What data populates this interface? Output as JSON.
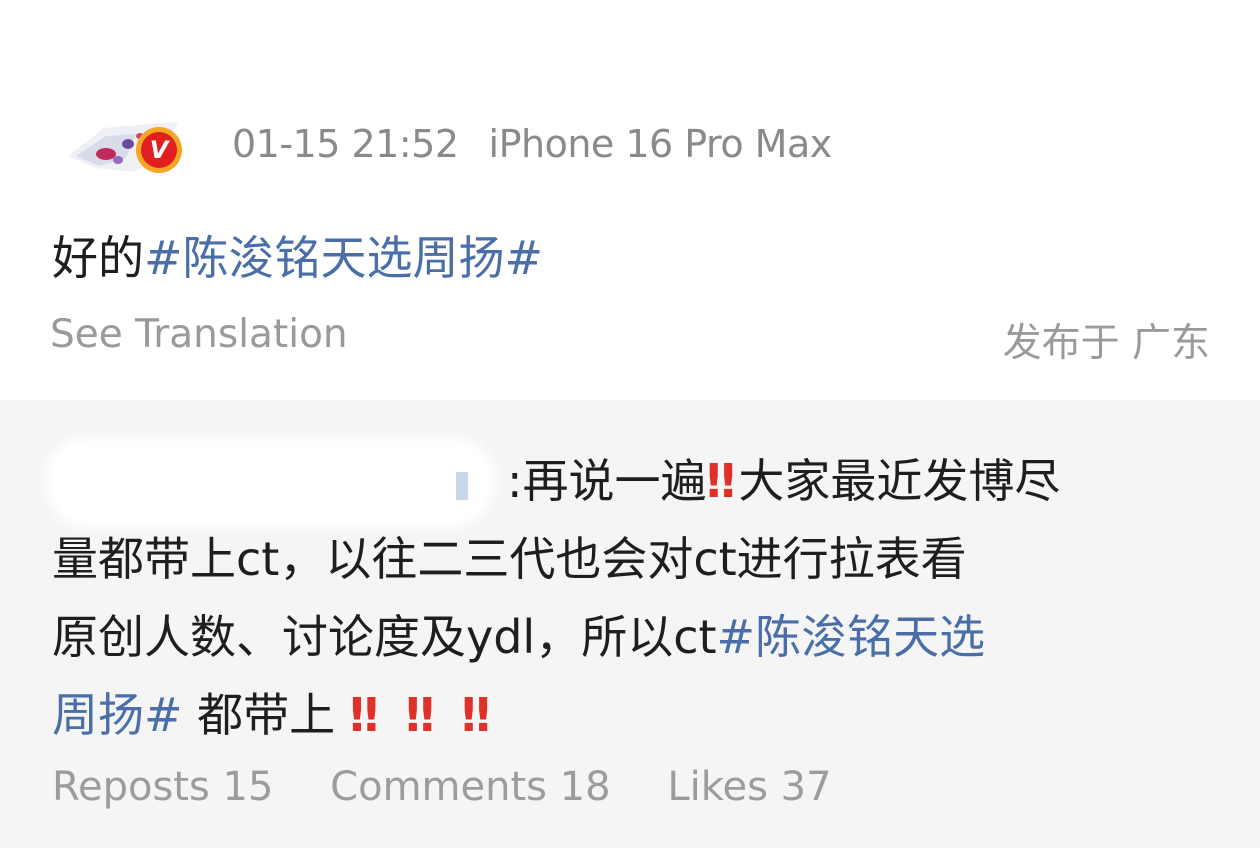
{
  "post": {
    "time": "01-15 21:52",
    "device": "iPhone 16 Pro Max",
    "text_plain": "好的",
    "text_hashtag": "#陈浚铭天选周扬#",
    "see_translation": "See Translation",
    "location": "发布于 广东"
  },
  "avatar": {
    "badge_letter": "V"
  },
  "repost": {
    "line1_text": ":再说一遍",
    "line1_text_b": "大家最近发博尽",
    "line2_text": "量都带上ct，以往二三代也会对ct进行拉表看",
    "line3_text": "原创人数、讨论度及ydl，所以ct",
    "line3_hashtag": "#陈浚铭天选",
    "line4_hashtag": "周扬#",
    "line4_text": " 都带上",
    "emphasis_mark": "‼"
  },
  "stats": {
    "reposts": "Reposts 15",
    "comments": "Comments 18",
    "likes": "Likes 37"
  },
  "colors": {
    "hashtag": "#4a6ea8",
    "emphasis": "#e0302a",
    "secondary_text": "#8a8a8a",
    "repost_background": "#f5f5f5"
  }
}
